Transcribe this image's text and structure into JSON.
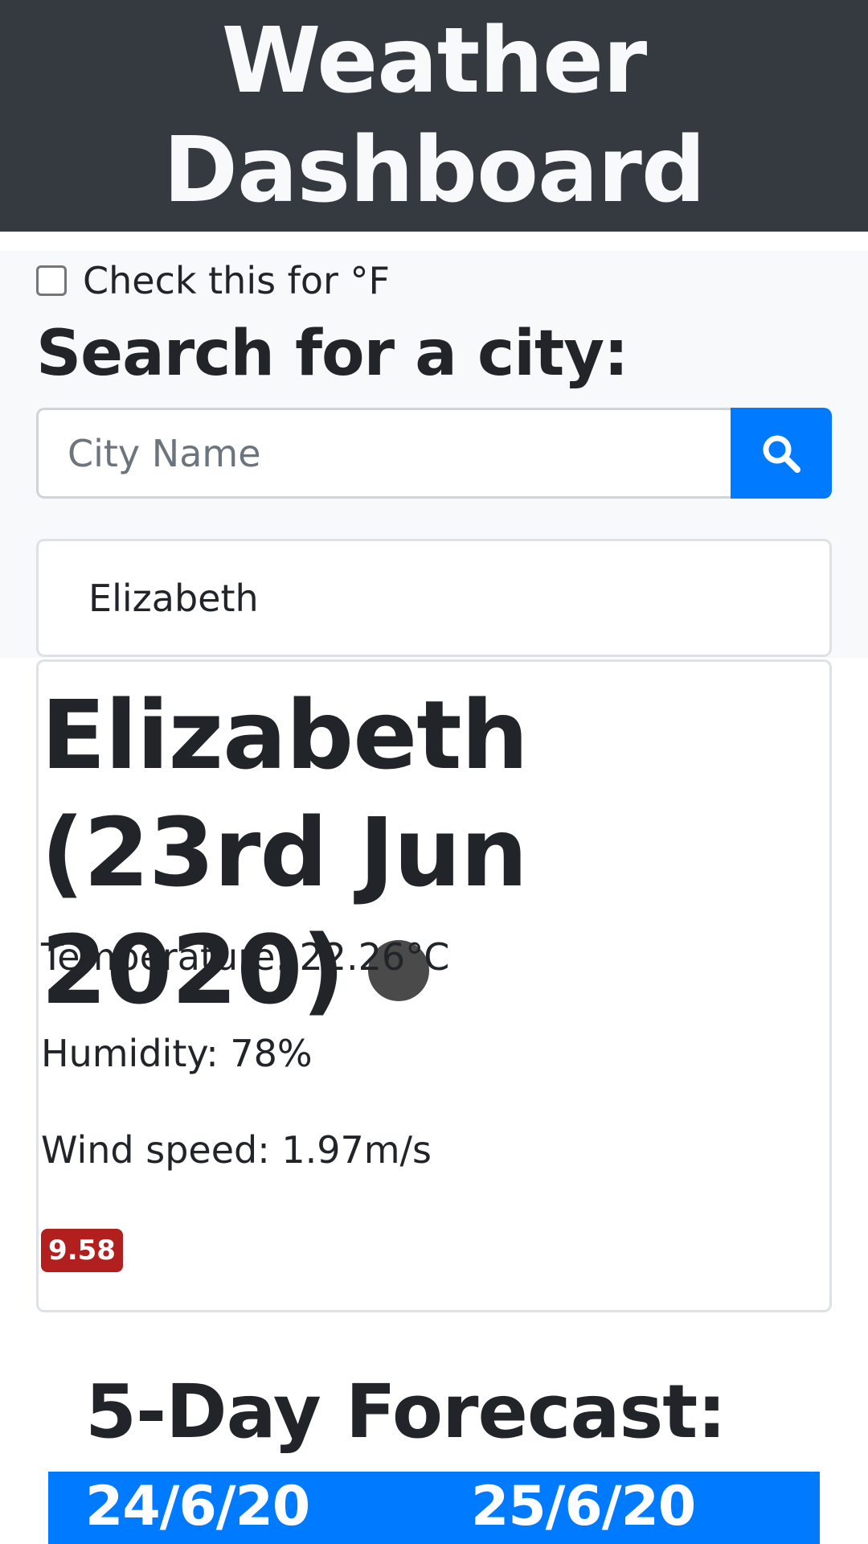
{
  "header": {
    "title": "Weather Dashboard"
  },
  "search": {
    "unit_toggle_label": "Check this for °F",
    "heading": "Search for a city:",
    "input_placeholder": "City Name",
    "input_value": "",
    "button_icon": "search-icon"
  },
  "history": {
    "items": [
      "Elizabeth"
    ]
  },
  "current": {
    "title": "Elizabeth (23rd Jun 2020)",
    "icon": "weather-icon",
    "temperature": "Temperature: 22.26°C",
    "humidity": "Humidity: 78%",
    "wind": "Wind speed: 1.97m/s",
    "uv_index": "9.58"
  },
  "forecast": {
    "heading": "5-Day Forecast:",
    "days": [
      {
        "date": "24/6/20"
      },
      {
        "date": "25/6/20"
      }
    ]
  },
  "colors": {
    "header_bg": "#343a40",
    "accent": "#007bff",
    "uv_badge": "#b21f1f"
  }
}
